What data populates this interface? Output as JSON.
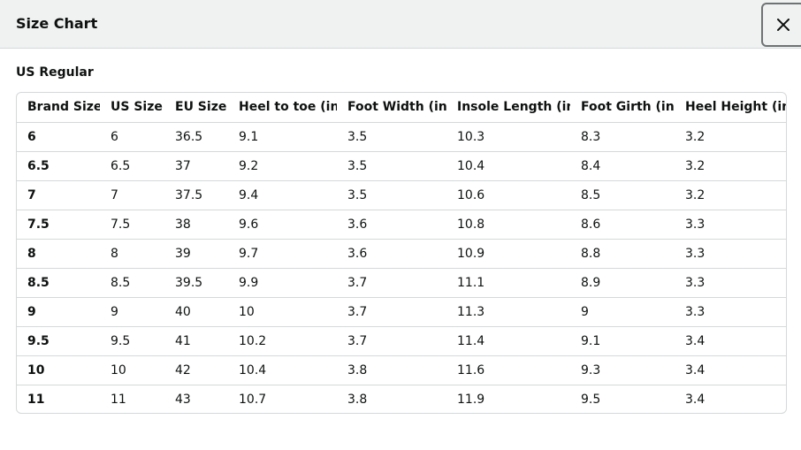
{
  "dialog": {
    "title": "Size Chart",
    "close_icon": "close-icon"
  },
  "section": {
    "label": "US Regular"
  },
  "table": {
    "headers": [
      "Brand Size",
      "US Size",
      "EU Size",
      "Heel to toe (in)",
      "Foot Width (in)",
      "Insole Length (in)",
      "Foot Girth (in)",
      "Heel Height (in)"
    ],
    "rows": [
      [
        "6",
        "6",
        "36.5",
        "9.1",
        "3.5",
        "10.3",
        "8.3",
        "3.2"
      ],
      [
        "6.5",
        "6.5",
        "37",
        "9.2",
        "3.5",
        "10.4",
        "8.4",
        "3.2"
      ],
      [
        "7",
        "7",
        "37.5",
        "9.4",
        "3.5",
        "10.6",
        "8.5",
        "3.2"
      ],
      [
        "7.5",
        "7.5",
        "38",
        "9.6",
        "3.6",
        "10.8",
        "8.6",
        "3.3"
      ],
      [
        "8",
        "8",
        "39",
        "9.7",
        "3.6",
        "10.9",
        "8.8",
        "3.3"
      ],
      [
        "8.5",
        "8.5",
        "39.5",
        "9.9",
        "3.7",
        "11.1",
        "8.9",
        "3.3"
      ],
      [
        "9",
        "9",
        "40",
        "10",
        "3.7",
        "11.3",
        "9",
        "3.3"
      ],
      [
        "9.5",
        "9.5",
        "41",
        "10.2",
        "3.7",
        "11.4",
        "9.1",
        "3.4"
      ],
      [
        "10",
        "10",
        "42",
        "10.4",
        "3.8",
        "11.6",
        "9.3",
        "3.4"
      ],
      [
        "11",
        "11",
        "43",
        "10.7",
        "3.8",
        "11.9",
        "9.5",
        "3.4"
      ]
    ]
  }
}
